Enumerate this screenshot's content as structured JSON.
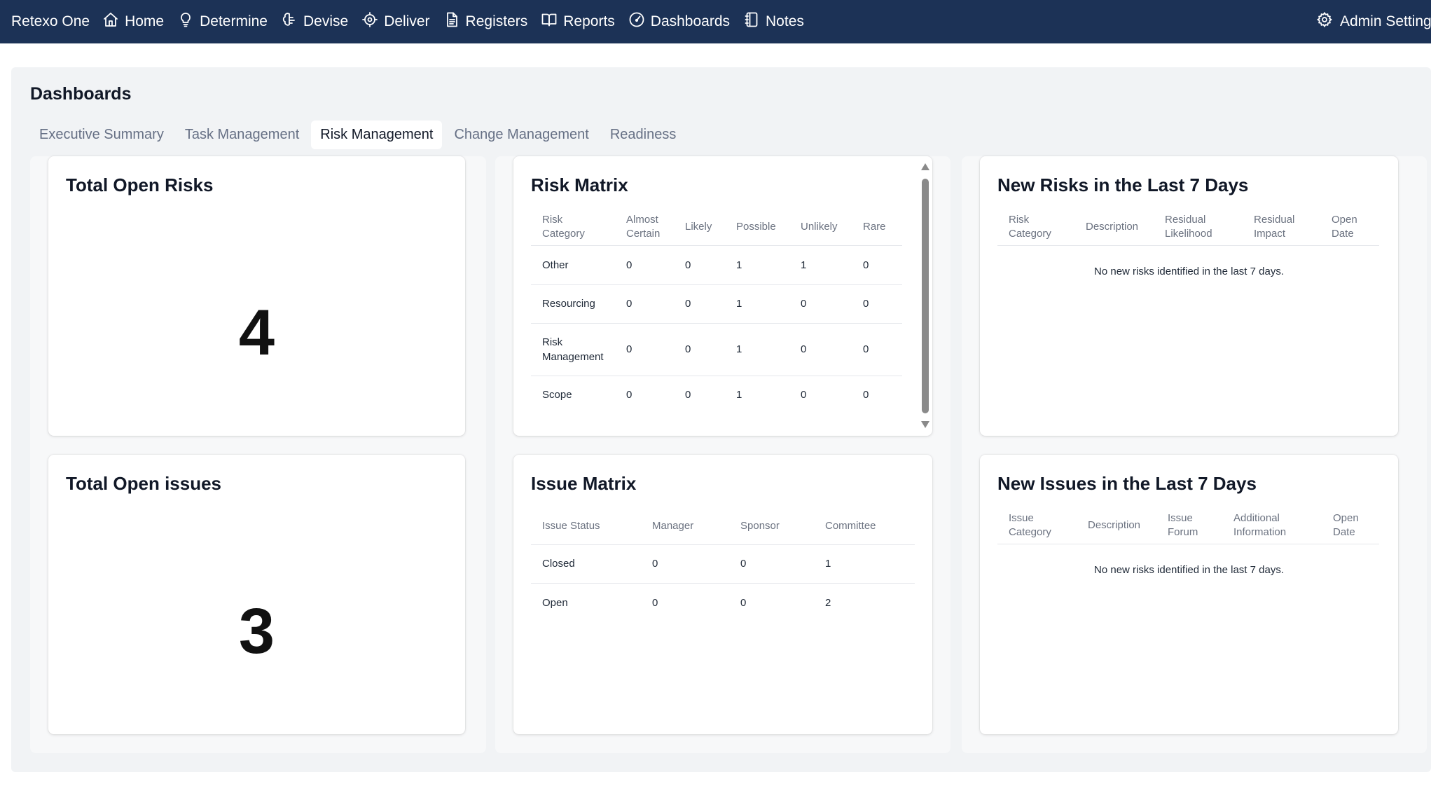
{
  "nav": {
    "brand": "Retexo One",
    "items": [
      {
        "label": "Home",
        "icon": "home-icon"
      },
      {
        "label": "Determine",
        "icon": "lightbulb-icon"
      },
      {
        "label": "Devise",
        "icon": "brain-icon"
      },
      {
        "label": "Deliver",
        "icon": "target-icon"
      },
      {
        "label": "Registers",
        "icon": "document-icon"
      },
      {
        "label": "Reports",
        "icon": "book-icon"
      },
      {
        "label": "Dashboards",
        "icon": "gauge-icon"
      },
      {
        "label": "Notes",
        "icon": "notebook-icon"
      }
    ],
    "admin_label": "Admin Settings",
    "colors": {
      "bar": "#1c3256",
      "text": "#ffffff"
    }
  },
  "page": {
    "title": "Dashboards",
    "tabs": [
      {
        "label": "Executive Summary",
        "active": false
      },
      {
        "label": "Task Management",
        "active": false
      },
      {
        "label": "Risk Management",
        "active": true
      },
      {
        "label": "Change Management",
        "active": false
      },
      {
        "label": "Readiness",
        "active": false
      }
    ]
  },
  "cards": {
    "total_open_risks": {
      "title": "Total Open Risks",
      "value": "4"
    },
    "total_open_issues": {
      "title": "Total Open issues",
      "value": "3"
    },
    "risk_matrix": {
      "title": "Risk Matrix",
      "headers": [
        "Risk Category",
        "Almost Certain",
        "Likely",
        "Possible",
        "Unlikely",
        "Rare"
      ],
      "rows": [
        [
          "Other",
          "0",
          "0",
          "1",
          "1",
          "0"
        ],
        [
          "Resourcing",
          "0",
          "0",
          "1",
          "0",
          "0"
        ],
        [
          "Risk Management",
          "0",
          "0",
          "1",
          "0",
          "0"
        ],
        [
          "Scope",
          "0",
          "0",
          "1",
          "0",
          "0"
        ]
      ]
    },
    "issue_matrix": {
      "title": "Issue Matrix",
      "headers": [
        "Issue Status",
        "Manager",
        "Sponsor",
        "Committee"
      ],
      "rows": [
        [
          "Closed",
          "0",
          "0",
          "1"
        ],
        [
          "Open",
          "0",
          "0",
          "2"
        ]
      ]
    },
    "new_risks": {
      "title": "New Risks in the Last 7 Days",
      "headers": [
        "Risk Category",
        "Description",
        "Residual Likelihood",
        "Residual Impact",
        "Open Date"
      ],
      "empty_message": "No new risks identified in the last 7 days."
    },
    "new_issues": {
      "title": "New Issues in the Last 7 Days",
      "headers": [
        "Issue Category",
        "Description",
        "Issue Forum",
        "Additional Information",
        "Open Date"
      ],
      "empty_message": "No new risks identified in the last 7 days."
    }
  }
}
